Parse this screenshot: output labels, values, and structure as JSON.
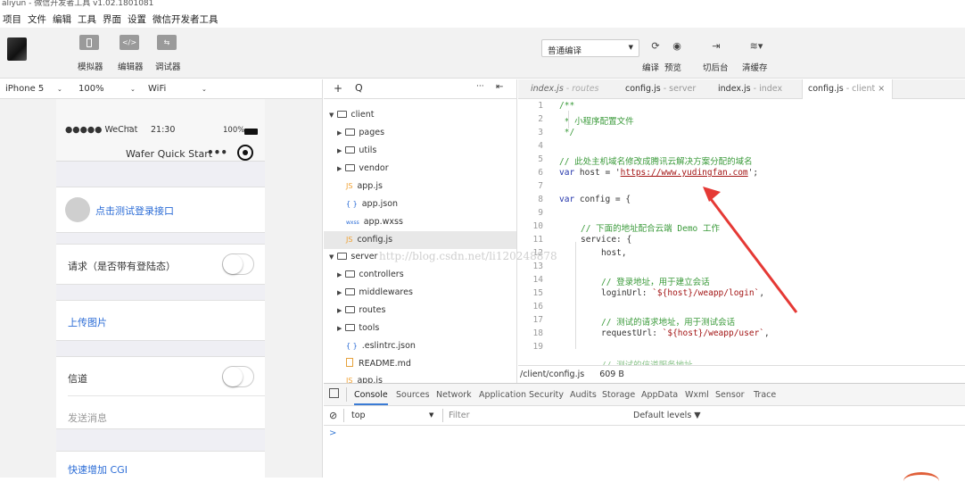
{
  "window": {
    "title": "aliyun - 微信开发者工具 v1.02.1801081"
  },
  "menu": [
    "项目",
    "文件",
    "编辑",
    "工具",
    "界面",
    "设置",
    "微信开发者工具"
  ],
  "toolbar": {
    "simulator": "模拟器",
    "editor": "编辑器",
    "debugger": "调试器",
    "compile_mode": "普通编译",
    "compile": "编译",
    "preview": "预览",
    "background": "切后台",
    "clear_cache": "清缓存"
  },
  "device_bar": {
    "device": "iPhone 5",
    "zoom": "100%",
    "network": "WiFi"
  },
  "phone": {
    "carrier": "●●●●● WeChat",
    "time": "21:30",
    "battery": "100%",
    "nav_title": "Wafer Quick Start",
    "nav_more": "•••",
    "login_text": "点击测试登录接口",
    "request_text": "请求（是否带有登陆态）",
    "upload_text": "上传图片",
    "tunnel_text": "信道",
    "send_text": "发送消息",
    "cgi_text": "快速增加 CGI"
  },
  "filebar": {
    "add": "+",
    "search": "Q",
    "more": "···",
    "collapse": "⇤"
  },
  "tree": [
    {
      "label": "client",
      "kind": "folder-open"
    },
    {
      "label": "pages",
      "kind": "folder"
    },
    {
      "label": "utils",
      "kind": "folder"
    },
    {
      "label": "vendor",
      "kind": "folder"
    },
    {
      "label": "app.js",
      "kind": "js"
    },
    {
      "label": "app.json",
      "kind": "json"
    },
    {
      "label": "app.wxss",
      "kind": "wxss"
    },
    {
      "label": "config.js",
      "kind": "js"
    },
    {
      "label": "server",
      "kind": "folder-open"
    },
    {
      "label": "controllers",
      "kind": "folder"
    },
    {
      "label": "middlewares",
      "kind": "folder"
    },
    {
      "label": "routes",
      "kind": "folder"
    },
    {
      "label": "tools",
      "kind": "folder"
    },
    {
      "label": ".eslintrc.json",
      "kind": "json"
    },
    {
      "label": "README.md",
      "kind": "md"
    },
    {
      "label": "app.js",
      "kind": "js"
    }
  ],
  "tabs": [
    {
      "name": "index.js",
      "dir": " - routes"
    },
    {
      "name": "config.js",
      "dir": " - server"
    },
    {
      "name": "index.js",
      "dir": " - index"
    },
    {
      "name": "config.js",
      "dir": " - client"
    }
  ],
  "tab_close": "×",
  "code": {
    "line_numbers": [
      "1",
      "2",
      "3",
      "4",
      "5",
      "6",
      "7",
      "8",
      "9",
      "10",
      "11",
      "12",
      "13",
      "14",
      "15",
      "16",
      "17",
      "18",
      "19"
    ],
    "l1": "/**",
    "l2": " * 小程序配置文件",
    "l3": " */",
    "l5": "// 此处主机域名修改成腾讯云解决方案分配的域名",
    "l6_kw": "var",
    "l6_a": " host = '",
    "l6_url": "https://www.yudingfan.com",
    "l6_b": "';",
    "l8_kw": "var",
    "l8_a": " config = {",
    "l10": "// 下面的地址配合云端 Demo 工作",
    "l11": "service: {",
    "l12": "host,",
    "l14": "// 登录地址，用于建立会话",
    "l15_a": "loginUrl: ",
    "l15_s": "`${host}/weapp/login`",
    "l15_b": ",",
    "l17": "// 测试的请求地址，用于测试会话",
    "l18_a": "requestUrl: ",
    "l18_s": "`${host}/weapp/user`",
    "l18_b": ",",
    "l20": "// 测试的信道服务地址"
  },
  "statusbar": {
    "path": "/client/config.js",
    "size": "609 B"
  },
  "devtools_tabs": [
    "Console",
    "Sources",
    "Network",
    "Application",
    "Security",
    "Audits",
    "Storage",
    "AppData",
    "Wxml",
    "Sensor",
    "Trace"
  ],
  "console": {
    "context": "top",
    "filter_placeholder": "Filter",
    "levels": "Default levels ▼",
    "prompt": ">"
  },
  "watermark": "http://blog.csdn.net/li120248878",
  "colors": {
    "arrow": "#e53935",
    "js": "#f0a030",
    "comment": "#3a9a3a"
  }
}
